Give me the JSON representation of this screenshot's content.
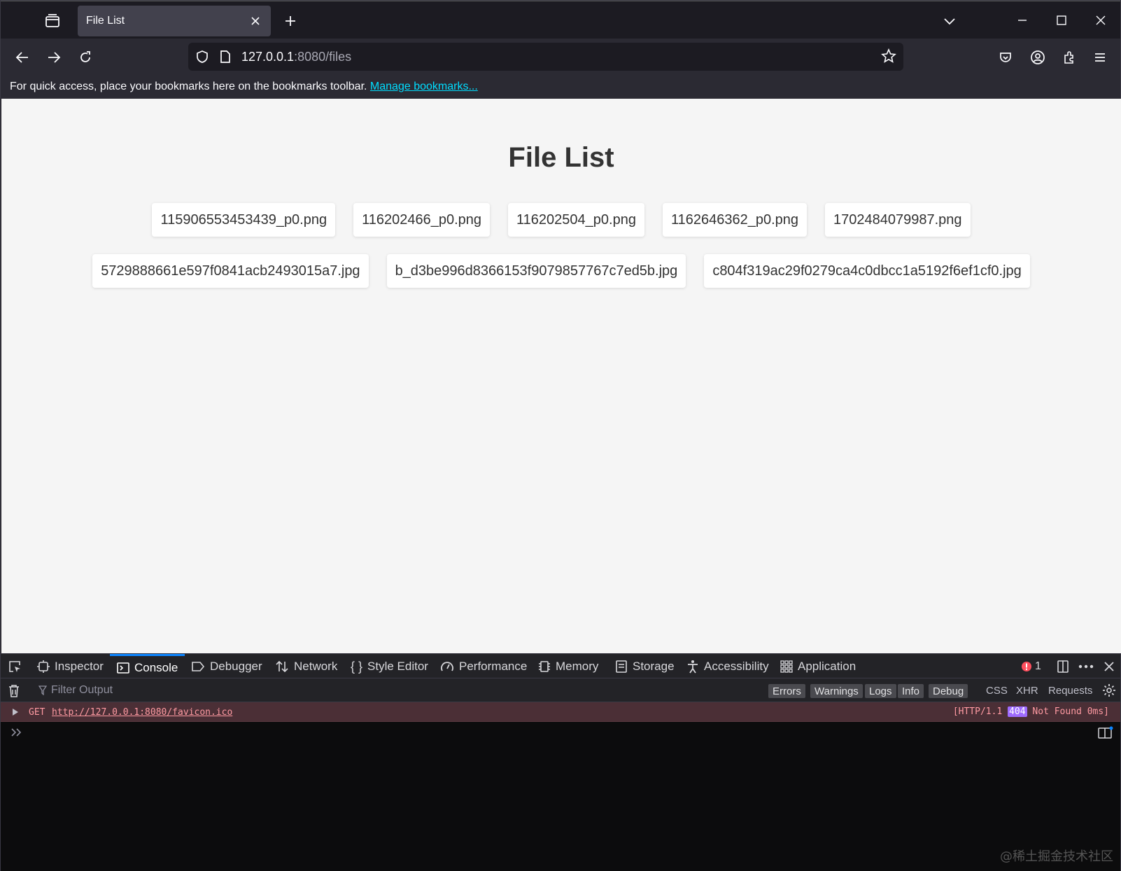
{
  "browser": {
    "tab_title": "File List",
    "url_host": "127.0.0.1",
    "url_rest": ":8080/files",
    "bookmarks_text": "For quick access, place your bookmarks here on the bookmarks toolbar.",
    "bookmarks_link": "Manage bookmarks..."
  },
  "page": {
    "title": "File List",
    "files_row1": [
      "115906553453439_p0.png",
      "116202466_p0.png",
      "116202504_p0.png",
      "1162646362_p0.png",
      "1702484079987.png"
    ],
    "files_row2": [
      "5729888661e597f0841acb2493015a7.jpg",
      "b_d3be996d8366153f9079857767c7ed5b.jpg",
      "c804f319ac29f0279ca4c0dbcc1a5192f6ef1cf0.jpg"
    ]
  },
  "devtools": {
    "tabs": [
      "Inspector",
      "Console",
      "Debugger",
      "Network",
      "Style Editor",
      "Performance",
      "Memory",
      "Storage",
      "Accessibility",
      "Application"
    ],
    "active_tab": "Console",
    "error_count": "1",
    "filter_placeholder": "Filter Output",
    "levels": [
      "Errors",
      "Warnings",
      "Logs",
      "Info",
      "Debug"
    ],
    "filters": [
      "CSS",
      "XHR",
      "Requests"
    ],
    "message": {
      "method": "GET",
      "url": "http://127.0.0.1:8080/favicon.ico",
      "status_prefix": "[HTTP/1.1",
      "status_code": "404",
      "status_suffix": "Not Found 0ms]"
    }
  },
  "watermark": "@稀土掘金技术社区",
  "colors": {
    "accent": "#0a84ff",
    "link": "#00ddff",
    "error_bg": "#4b2f36"
  }
}
